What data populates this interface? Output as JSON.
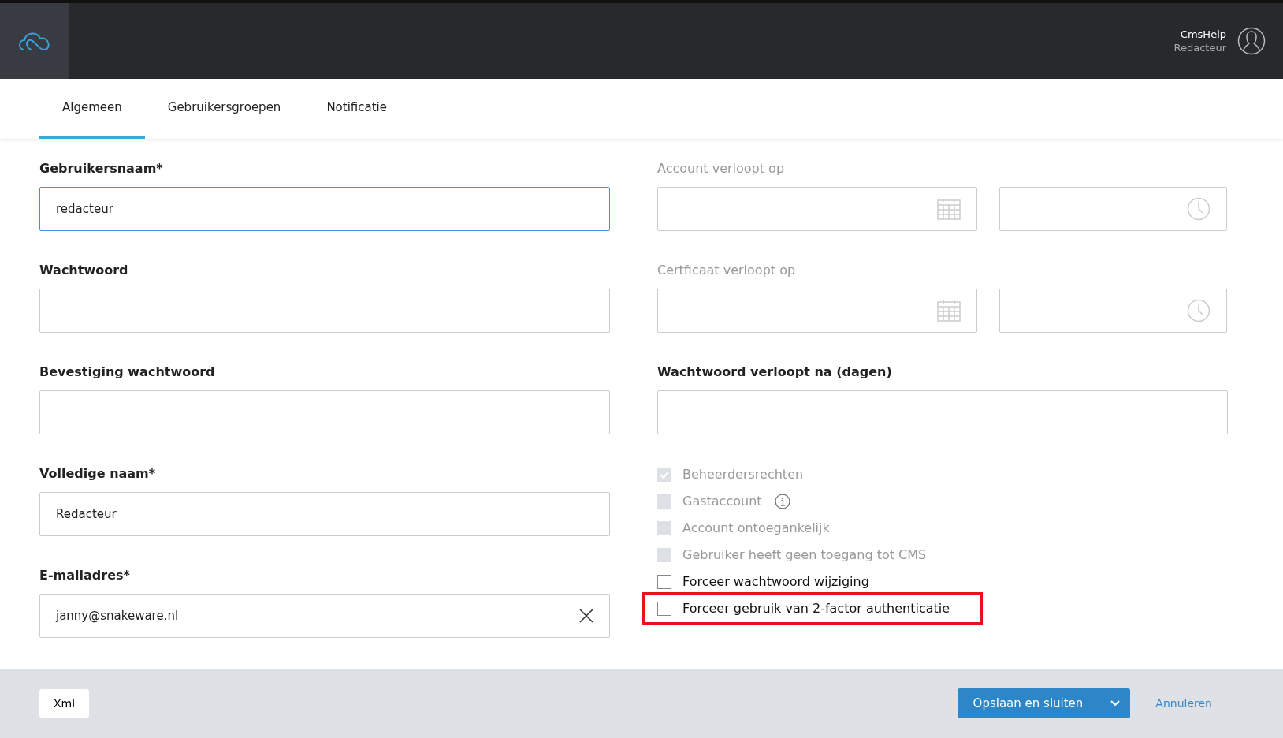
{
  "header": {
    "user_name": "CmsHelp",
    "user_role": "Redacteur"
  },
  "tabs": [
    {
      "label": "Algemeen",
      "selected": true
    },
    {
      "label": "Gebruikersgroepen",
      "selected": false
    },
    {
      "label": "Notificatie",
      "selected": false
    }
  ],
  "left_fields": [
    {
      "label": "Gebruikersnaam*",
      "value": "redacteur",
      "focused": true,
      "clearable": false
    },
    {
      "label": "Wachtwoord",
      "focused": false,
      "clearable": false
    },
    {
      "label": "Bevestiging wachtwoord",
      "focused": false,
      "clearable": false
    },
    {
      "label": "Volledige naam*",
      "value": "Redacteur",
      "focused": false,
      "clearable": false
    },
    {
      "label": "E-mailadres*",
      "value": "janny@snakeware.nl",
      "focused": false,
      "clearable": true
    }
  ],
  "right_fields": [
    {
      "label": "Account verloopt op",
      "kind": "datetime",
      "disabled": true
    },
    {
      "label": "Certficaat verloopt op",
      "kind": "datetime",
      "disabled": true
    },
    {
      "label": "Wachtwoord verloopt na (dagen)",
      "kind": "text",
      "disabled": false
    }
  ],
  "checkboxes": [
    {
      "label": "Beheerdersrechten",
      "checked": true,
      "disabled": true,
      "info": false,
      "highlighted": false
    },
    {
      "label": "Gastaccount",
      "checked": false,
      "disabled": true,
      "info": true,
      "highlighted": false
    },
    {
      "label": "Account ontoegankelijk",
      "checked": false,
      "disabled": true,
      "info": false,
      "highlighted": false
    },
    {
      "label": "Gebruiker heeft geen toegang tot CMS",
      "checked": false,
      "disabled": true,
      "info": false,
      "highlighted": false
    },
    {
      "label": "Forceer wachtwoord wijziging",
      "checked": false,
      "disabled": false,
      "info": false,
      "highlighted": false
    },
    {
      "label": "Forceer gebruik van 2-factor authenticatie",
      "checked": false,
      "disabled": false,
      "info": false,
      "highlighted": true
    }
  ],
  "footer": {
    "xml_button": "Xml",
    "save_button": "Opslaan en sluiten",
    "cancel_link": "Annuleren"
  }
}
